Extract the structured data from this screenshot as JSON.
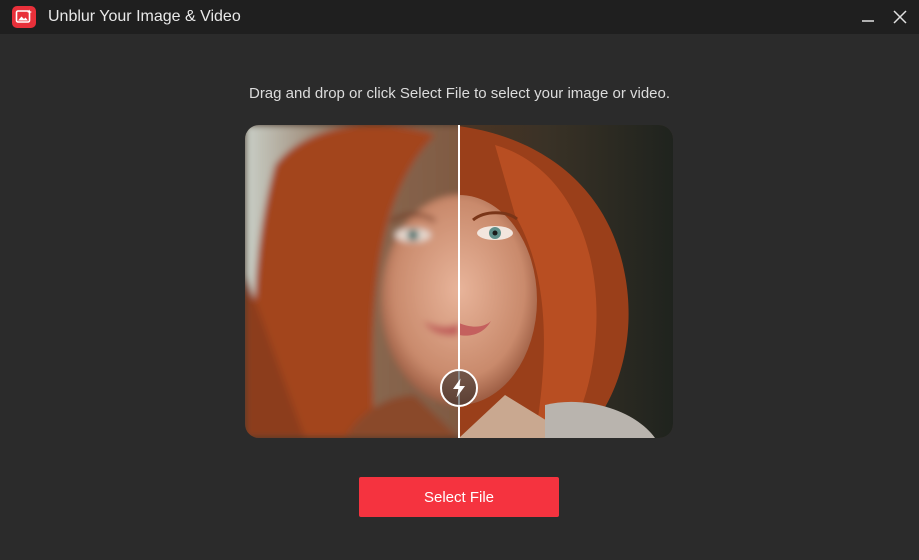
{
  "window": {
    "title": "Unblur Your Image & Video",
    "app_icon": "image-sparkle-icon",
    "controls": {
      "minimize_icon": "minimize-icon",
      "close_icon": "close-icon"
    }
  },
  "main": {
    "instruction": "Drag and drop or click Select File to select your image or video.",
    "preview": {
      "left_state": "blurred",
      "right_state": "enhanced",
      "handle_icon": "lightning-bolt-icon",
      "split_position": 0.5
    },
    "select_button_label": "Select File"
  },
  "colors": {
    "accent": "#f5333f",
    "app_icon_bg": "#e8303a",
    "background": "#2b2b2b",
    "titlebar": "#1f1f1f"
  }
}
